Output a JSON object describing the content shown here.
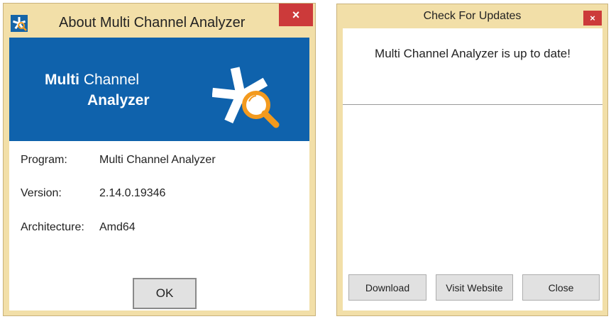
{
  "about_dialog": {
    "title": "About Multi Channel Analyzer",
    "close_label": "×",
    "banner": {
      "name_bold": "Multi",
      "name_regular": "Channel",
      "name_line2": "Analyzer"
    },
    "rows": [
      {
        "label": "Program:",
        "value": "Multi Channel Analyzer"
      },
      {
        "label": "Version:",
        "value": "2.14.0.19346"
      },
      {
        "label": "Architecture:",
        "value": "Amd64"
      }
    ],
    "ok_label": "OK"
  },
  "updates_dialog": {
    "title": "Check For Updates",
    "close_label": "×",
    "message": "Multi Channel Analyzer is up to date!",
    "buttons": {
      "download": "Download",
      "visit_website": "Visit Website",
      "close": "Close"
    }
  },
  "colors": {
    "frame": "#f2dfa8",
    "banner": "#0f62ac",
    "close_button": "#cc3a3a",
    "magnifier": "#f39a1e"
  },
  "icons": {
    "app": "app-logo-icon",
    "close": "close-icon",
    "logo": "asterisk-magnifier-icon"
  }
}
